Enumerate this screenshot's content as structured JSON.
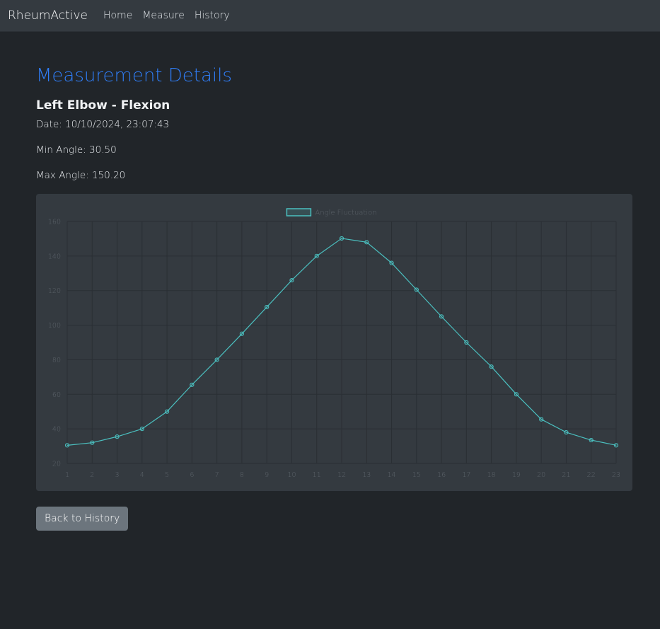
{
  "nav": {
    "brand": "RheumActive",
    "links": [
      "Home",
      "Measure",
      "History"
    ]
  },
  "page": {
    "title": "Measurement Details",
    "subtitle": "Left Elbow - Flexion",
    "date_line": "Date: 10/10/2024, 23:07:43",
    "min_line": "Min Angle: 30.50",
    "max_line": "Max Angle: 150.20"
  },
  "back_button": "Back to History",
  "colors": {
    "accent": "#2f7df6",
    "series": "#4bc0c0",
    "background": "#212529",
    "panel": "#343a40"
  },
  "chart_data": {
    "type": "line",
    "x": [
      1,
      2,
      3,
      4,
      5,
      6,
      7,
      8,
      9,
      10,
      11,
      12,
      13,
      14,
      15,
      16,
      17,
      18,
      19,
      20,
      21,
      22,
      23
    ],
    "series": [
      {
        "name": "Angle Fluctuation",
        "values": [
          30.5,
          32,
          35.5,
          40,
          50,
          65.5,
          80,
          95,
          110.5,
          126,
          140,
          150.2,
          148,
          136,
          120.5,
          105,
          90,
          76,
          60,
          45.5,
          38,
          33.5,
          30.5
        ]
      }
    ],
    "ylim": [
      20,
      160
    ],
    "yticks": [
      20,
      40,
      60,
      80,
      100,
      120,
      140,
      160
    ],
    "grid": true,
    "legend": "top-center"
  }
}
